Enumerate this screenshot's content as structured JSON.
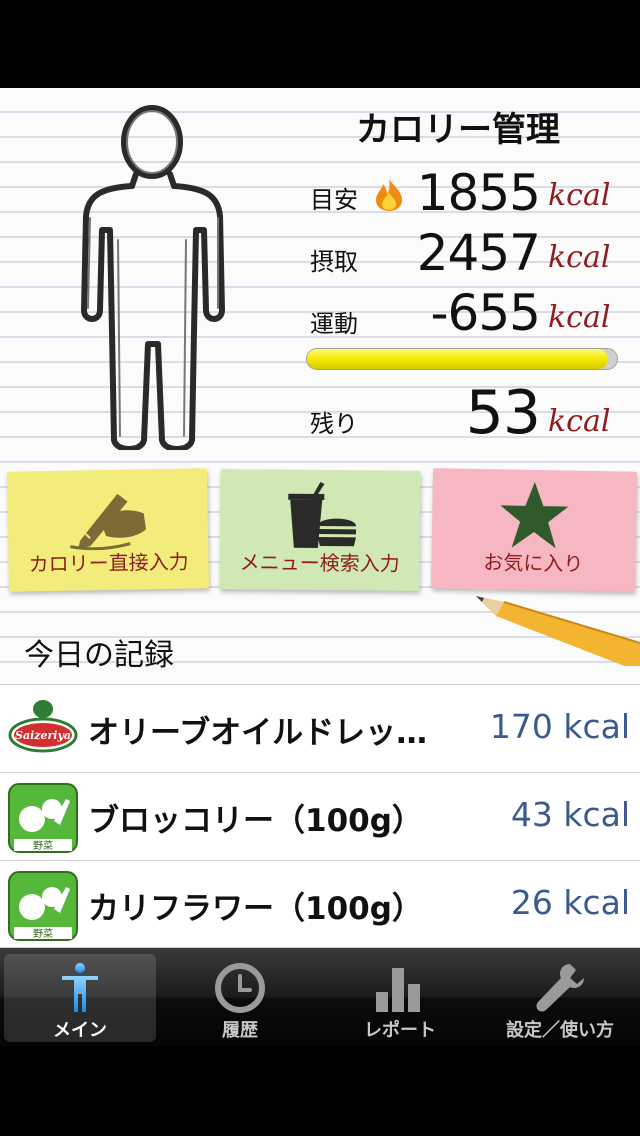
{
  "header": {
    "title": "カロリー管理"
  },
  "stats": {
    "target": {
      "label": "目安",
      "value": "1855",
      "unit": "kcal"
    },
    "intake": {
      "label": "摂取",
      "value": "2457",
      "unit": "kcal"
    },
    "exercise": {
      "label": "運動",
      "value": "-655",
      "unit": "kcal"
    },
    "remaining": {
      "label": "残り",
      "value": "53",
      "unit": "kcal"
    },
    "progress_fraction": 0.97
  },
  "actions": {
    "direct_input": "カロリー直接入力",
    "menu_search": "メニュー検索入力",
    "favorites": "お気に入り"
  },
  "records": {
    "heading": "今日の記録",
    "items": [
      {
        "name": "オリーブオイルドレッ…",
        "kcal": "170 kcal",
        "icon": "saizeriya-logo",
        "icon_text": "Saizeriya"
      },
      {
        "name": "ブロッコリー（100g）",
        "kcal": "43 kcal",
        "icon": "vegetable-icon",
        "icon_text": "野菜"
      },
      {
        "name": "カリフラワー（100g）",
        "kcal": "26 kcal",
        "icon": "vegetable-icon",
        "icon_text": "野菜"
      }
    ]
  },
  "tabs": [
    {
      "label": "メイン",
      "icon": "person-icon",
      "active": true
    },
    {
      "label": "履歴",
      "icon": "clock-icon",
      "active": false
    },
    {
      "label": "レポート",
      "icon": "bar-chart-icon",
      "active": false
    },
    {
      "label": "設定／使い方",
      "icon": "wrench-icon",
      "active": false
    }
  ],
  "colors": {
    "unit_red": "#8e1d1d",
    "kcal_blue": "#3b5b8f",
    "note_yellow": "#f2ec7a",
    "note_green": "#cfe8b4",
    "note_pink": "#f7b7c2",
    "progress_yellow": "#f3e900"
  }
}
